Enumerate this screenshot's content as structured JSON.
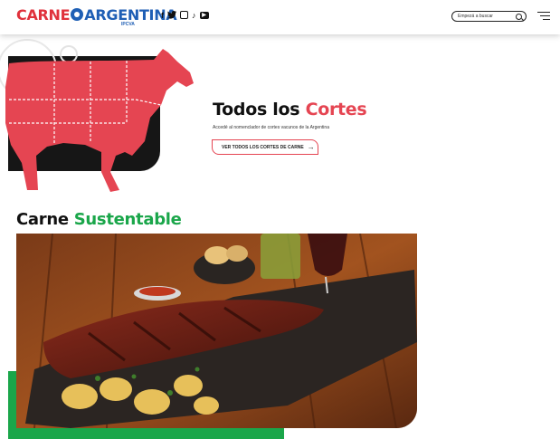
{
  "header": {
    "logo_word1": "CARNE",
    "logo_word2": "ARGENTINA",
    "logo_sub": "IPCVA",
    "social": [
      "facebook-icon",
      "twitter-icon",
      "instagram-icon",
      "tiktok-icon",
      "youtube-icon"
    ],
    "search_placeholder": "Empezá a buscar"
  },
  "hero": {
    "title_part1": "Todos los ",
    "title_part2": "Cortes",
    "subtitle": "Accedé al nomenclador de cortes vacunos de la Argentina",
    "cta_label": "VER TODOS LOS CORTES DE CARNE"
  },
  "section": {
    "title_part1": "Carne ",
    "title_part2": "Sustentable"
  },
  "colors": {
    "red": "#e54552",
    "green": "#1aa64a",
    "blue": "#1f5fb5",
    "black": "#161616"
  }
}
